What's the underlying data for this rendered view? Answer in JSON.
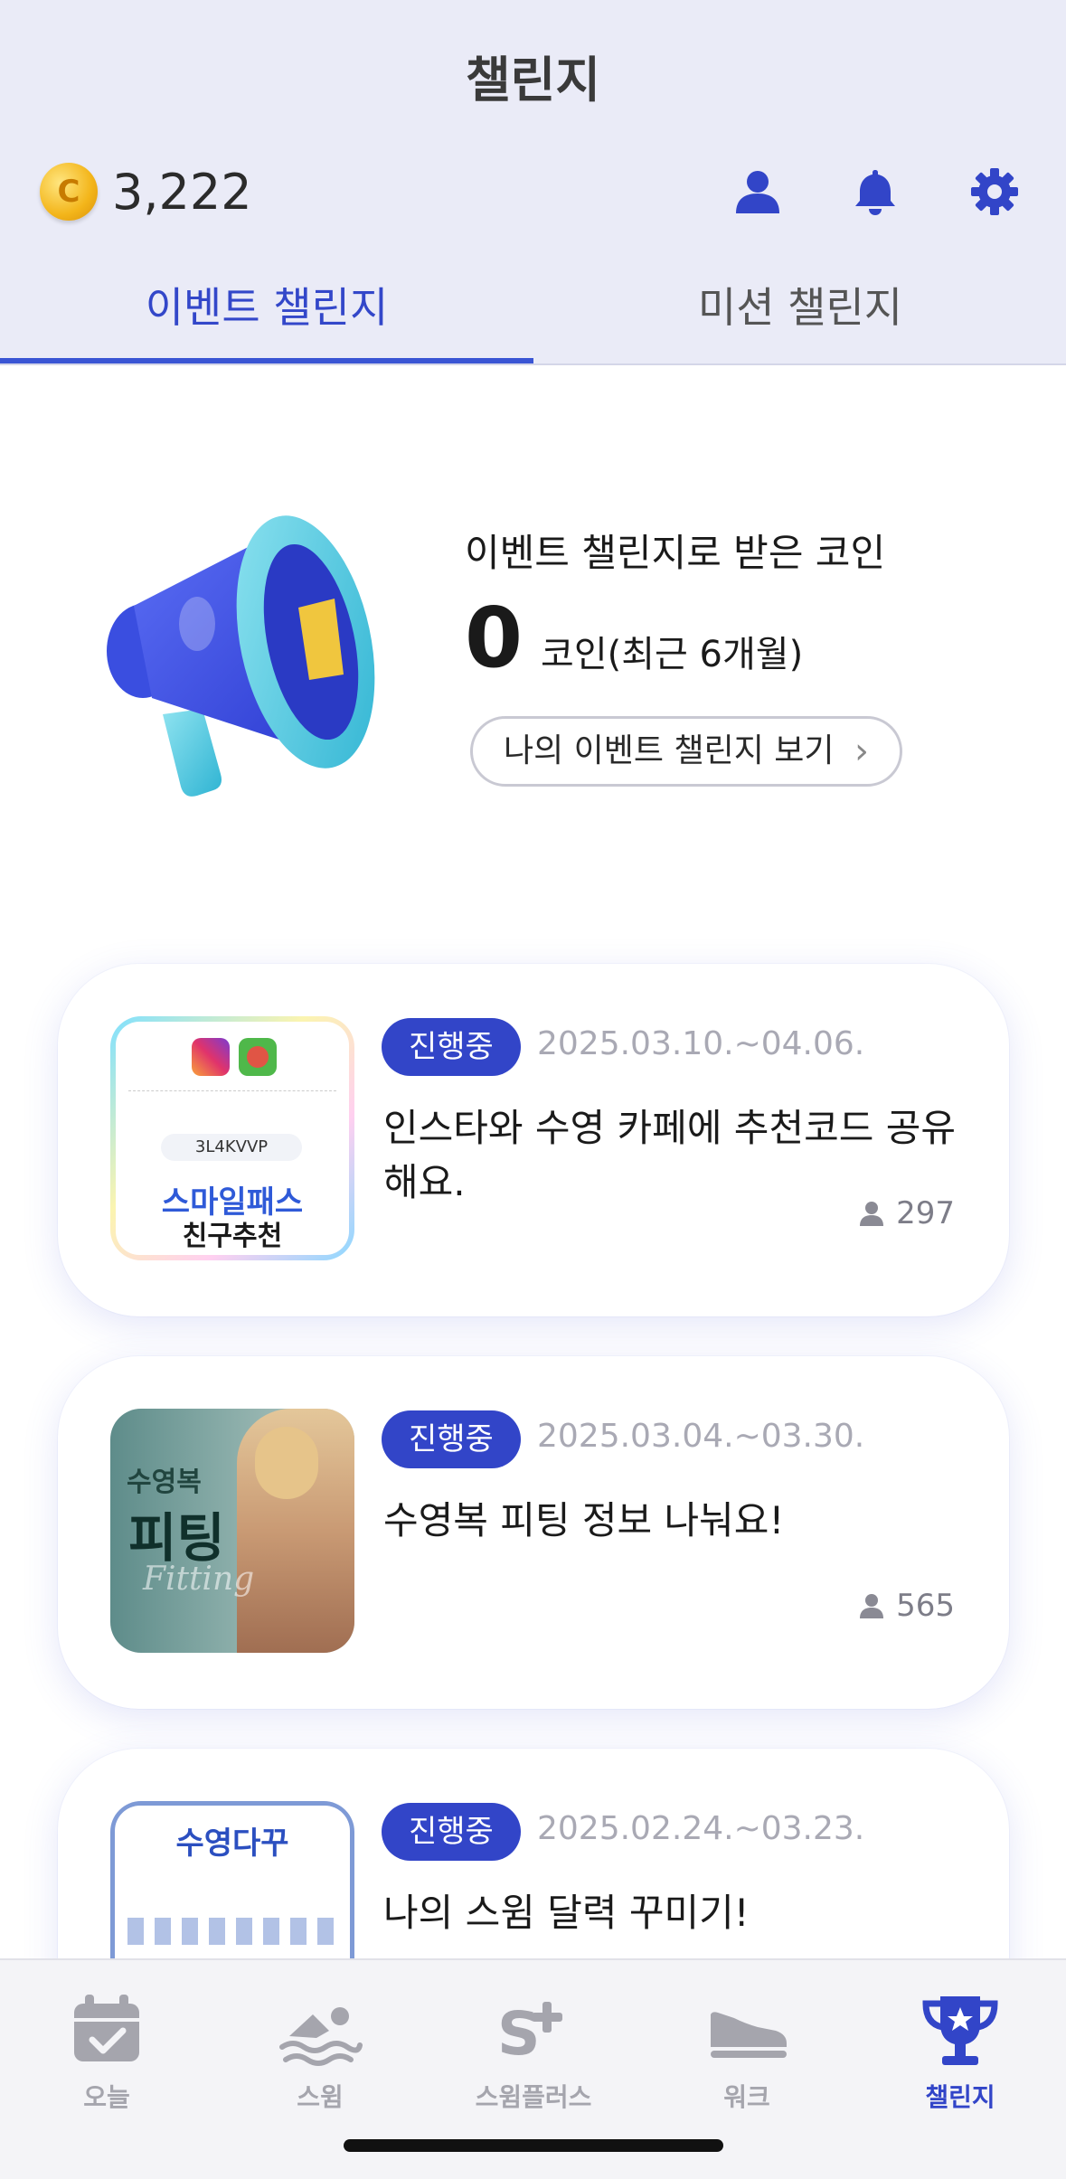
{
  "header": {
    "title": "챌린지",
    "coin_balance": "3,222",
    "coin_symbol": "C"
  },
  "tabs": [
    {
      "label": "이벤트 챌린지",
      "active": true
    },
    {
      "label": "미션 챌린지",
      "active": false
    }
  ],
  "summary": {
    "label": "이벤트 챌린지로 받은 코인",
    "amount": "0",
    "unit": "코인(최근 6개월)",
    "button_label": "나의 이벤트 챌린지 보기",
    "button_chevron": "›"
  },
  "cards": [
    {
      "status": "진행중",
      "date": "2025.03.10.~04.06.",
      "title": "인스타와 수영 카페에 추천코드 공유해요.",
      "participants": "297",
      "thumb": {
        "code": "3L4KVVP",
        "line1": "스마일패스",
        "line2": "친구추천"
      }
    },
    {
      "status": "진행중",
      "date": "2025.03.04.~03.30.",
      "title": "수영복 피팅 정보 나눠요!",
      "participants": "565",
      "thumb": {
        "line1": "수영복",
        "line2": "피팅",
        "line3": "Fitting"
      }
    },
    {
      "status": "진행중",
      "date": "2025.02.24.~03.23.",
      "title": "나의 스윔 달력 꾸미기!",
      "participants": "",
      "thumb": {
        "line1": "수영다꾸"
      }
    }
  ],
  "nav": [
    {
      "label": "오늘",
      "icon": "calendar-check-icon",
      "active": false
    },
    {
      "label": "스윔",
      "icon": "swimmer-icon",
      "active": false
    },
    {
      "label": "스윔플러스",
      "icon": "s-plus-icon",
      "active": false
    },
    {
      "label": "워크",
      "icon": "sneaker-icon",
      "active": false
    },
    {
      "label": "챌린지",
      "icon": "trophy-icon",
      "active": true
    }
  ],
  "colors": {
    "accent": "#3245c8",
    "header_bg": "#eaebf7",
    "muted": "#a5a5ad"
  }
}
